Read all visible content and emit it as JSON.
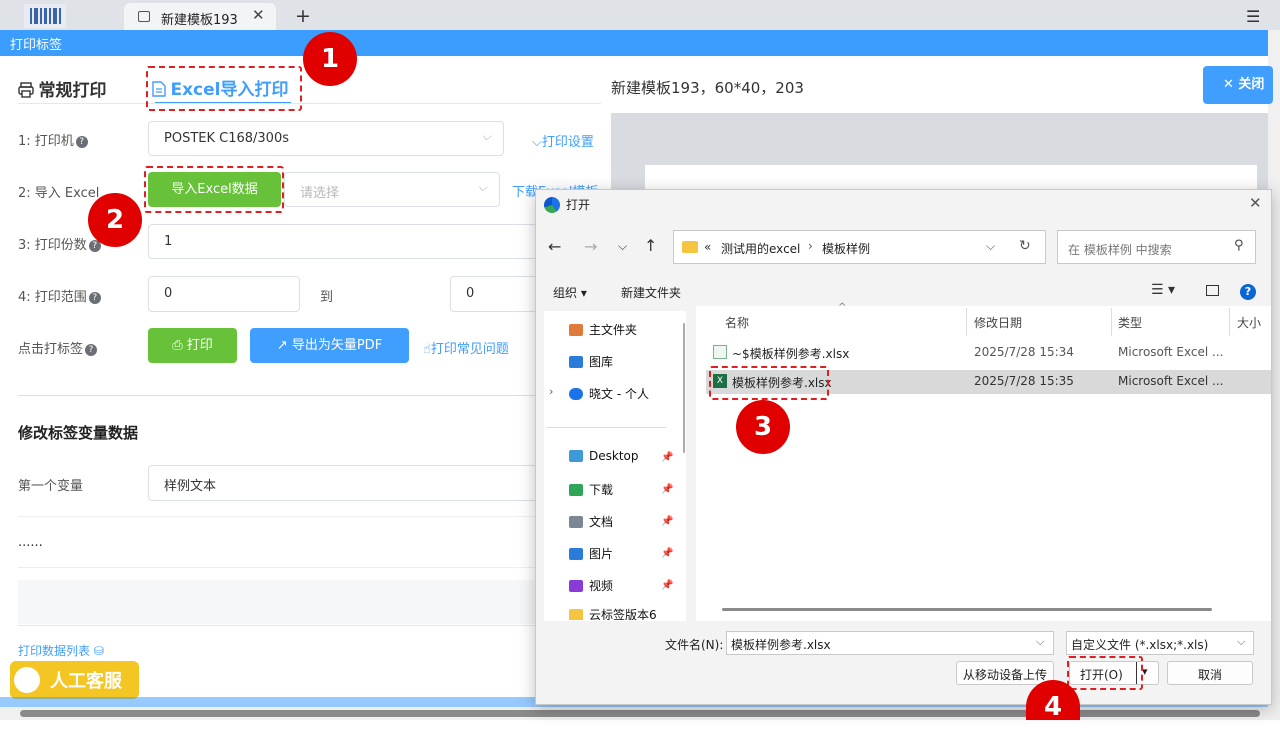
{
  "browser": {
    "tab_title": "新建模板193",
    "tab_close": "✕",
    "new_tab": "+",
    "menu": "☰"
  },
  "titlebar": {
    "title": "打印标签"
  },
  "tabs": {
    "normal": "常规打印",
    "excel": "Excel导入打印"
  },
  "template_info": "新建模板193，60*40，203",
  "close_btn": "关闭",
  "form": {
    "printer_label": "1: 打印机",
    "printer_value": "POSTEK C168/300s",
    "print_settings": "打印设置",
    "import_label": "2: 导入 Excel",
    "import_btn": "导入Excel数据",
    "select_placeholder": "请选择",
    "download_link": "下载Excel模板",
    "copies_label": "3: 打印份数",
    "copies_value": "1",
    "range_label": "4: 打印范围",
    "range_from": "0",
    "range_to_word": "到",
    "range_to": "0",
    "click_label": "点击打标签",
    "print_btn": "打印",
    "export_btn": "导出为矢量PDF",
    "faq_link": "打印常见问题"
  },
  "variables": {
    "section_title": "修改标签变量数据",
    "first_label": "第一个变量",
    "first_value": "样例文本",
    "more": "......"
  },
  "print_list": "打印数据列表",
  "support": "人工客服",
  "badges": [
    "1",
    "2",
    "3",
    "4"
  ],
  "dialog": {
    "title": "打开",
    "close": "✕",
    "breadcrumb_prefix": "«",
    "crumb1": "测试用的excel",
    "crumb_sep": "›",
    "crumb2": "模板样例",
    "search_placeholder": "在 模板样例 中搜索",
    "organize": "组织",
    "new_folder": "新建文件夹",
    "nav": [
      {
        "label": "主文件夹",
        "icon": "home-icon"
      },
      {
        "label": "图库",
        "icon": "gallery-icon"
      },
      {
        "label": "晓文 - 个人",
        "icon": "cloud-icon"
      },
      {
        "label": "Desktop",
        "icon": "desktop-icon"
      },
      {
        "label": "下载",
        "icon": "download-icon"
      },
      {
        "label": "文档",
        "icon": "document-icon"
      },
      {
        "label": "图片",
        "icon": "picture-icon"
      },
      {
        "label": "视频",
        "icon": "video-icon"
      },
      {
        "label": "云标签版本6",
        "icon": "folder-icon"
      }
    ],
    "columns": {
      "name": "名称",
      "date": "修改日期",
      "type": "类型",
      "size": "大小"
    },
    "files": [
      {
        "name": "~$模板样例参考.xlsx",
        "date": "2025/7/28 15:34",
        "type": "Microsoft Excel ..."
      },
      {
        "name": "模板样例参考.xlsx",
        "date": "2025/7/28 15:35",
        "type": "Microsoft Excel ..."
      }
    ],
    "filename_label": "文件名(N):",
    "filename_value": "模板样例参考.xlsx",
    "filter_value": "自定义文件 (*.xlsx;*.xls)",
    "upload_btn": "从移动设备上传",
    "open_btn": "打开(O)",
    "cancel_btn": "取消"
  }
}
